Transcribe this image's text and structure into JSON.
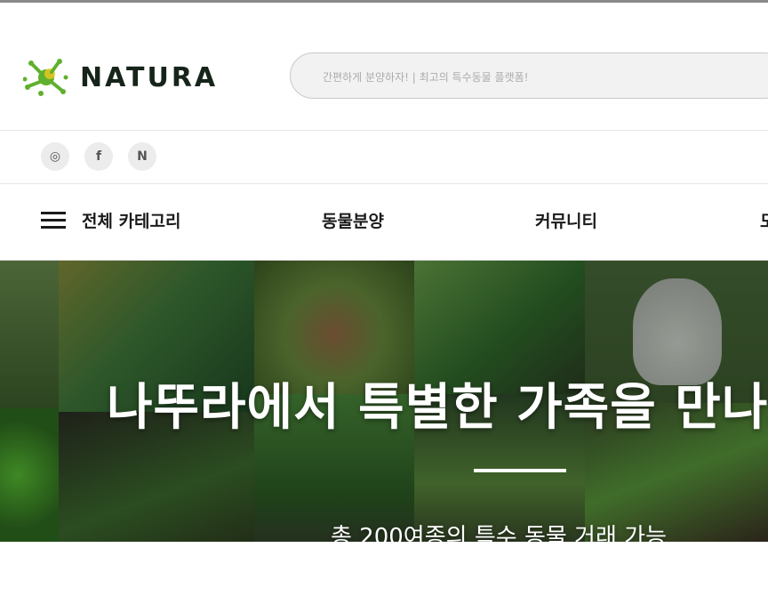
{
  "brand": {
    "name": "NATURA",
    "logo_colors": {
      "primary": "#5fb02e",
      "accent": "#e6c81d",
      "text": "#16241a"
    }
  },
  "search": {
    "placeholder": "간편하게 분양하자! | 최고의 특수동물 플랫폼!"
  },
  "social": [
    {
      "icon": "instagram-icon",
      "glyph": "◎"
    },
    {
      "icon": "facebook-icon",
      "glyph": "f"
    },
    {
      "icon": "naver-icon",
      "glyph": "N"
    }
  ],
  "nav": {
    "all_categories": "전체 카테고리",
    "items": [
      "동물분양",
      "커뮤니티",
      "도"
    ]
  },
  "hero": {
    "title": "나뚜라에서 특별한 가족을 만나보세요",
    "subtitle": "총 200여종의 특수 동물 거래 가능"
  }
}
